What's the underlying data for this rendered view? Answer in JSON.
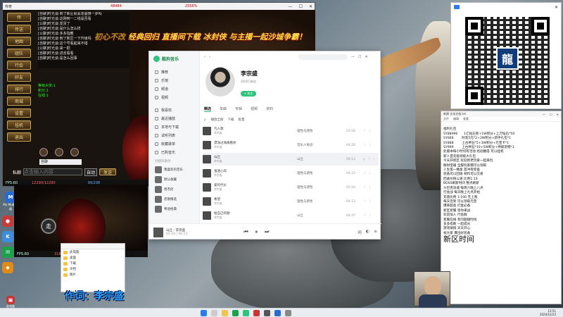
{
  "desktop": {
    "icons_left": [
      {
        "label": "Mu Mu模拟器",
        "color": "#2a6bd1"
      },
      {
        "label": "",
        "color": "#c73a3a"
      },
      {
        "label": "",
        "color": "#3b8de0"
      },
      {
        "label": "",
        "color": "#1aa34a"
      },
      {
        "label": "",
        "color": "#e08a1a"
      }
    ],
    "icons_bottom": [
      {
        "label": "此电脑",
        "color": "#c33"
      }
    ],
    "caption_label": "作词：",
    "caption_name": "李宗盛"
  },
  "game": {
    "window_title": "传奇",
    "counter_left": "48484",
    "counter_right": "2556%",
    "banner": "初心不改  经典回归  直播间下载  冰封侠  与主播一起沙城争霸！",
    "menu_buttons": [
      "传",
      "传送",
      "地图",
      "组队",
      "行会",
      "好友",
      "排行",
      "商城",
      "设置",
      "挂机",
      "退出"
    ],
    "chat": [
      "[自聊]时光谈:到了新区就会发展慢一步吗",
      "[自聊]时光谈:这刚到一二线是否看",
      "[公聊]时光谈:发货了",
      "[自聊]时光谈:是什么怎么样",
      "[公聊]时光谈:多多指教",
      "[自聊]时光谈:到了新区一下升级吗",
      "[自聊]时光谈:这个号看起来不错",
      "[公聊]时光谈:来一把",
      "[自聊]时光谈:进去看看",
      "[自聊]时光谈:是怎么回事"
    ],
    "chat_highlight": [
      "等级大奖:1",
      "积分:1",
      "在线:1"
    ],
    "channel": "自聊",
    "private_label": "私聊",
    "input_placeholder": "点击输入内容",
    "auto_label": "自动",
    "send_label": "发送",
    "hud_fps": "FPS:60",
    "hud_hp": "12290/12290",
    "hud_mp": "99/298",
    "bottom_fps": "FPS:60",
    "bottom_hp": "31844/31844",
    "walk_label": "走"
  },
  "music": {
    "app_name": "酷狗音乐",
    "nav": [
      "推荐",
      "乐馆",
      "频道",
      "视频"
    ],
    "nav2": [
      "我喜欢",
      "最近播放",
      "本地与下载",
      "试听列表",
      "收藏歌单",
      "已购音乐"
    ],
    "section_playlists": "创建的歌单",
    "playlists": [
      "我喜欢的音乐",
      "默认收藏",
      "周杰伦",
      "老歌精选",
      "粤语经典"
    ],
    "artist": "李宗盛",
    "artist_sub": "2000万粉丝",
    "follow": "+ 关注",
    "tabs": [
      "精选",
      "单曲",
      "专辑",
      "视频",
      "资料"
    ],
    "toolbar": [
      "播放全部",
      "下载",
      "批量"
    ],
    "songs": [
      {
        "name": "凡人歌",
        "artist": "李宗盛",
        "album": "理性与感性",
        "duration": "03:58"
      },
      {
        "name": "漂洋过海来看你",
        "artist": "李宗盛",
        "album": "音乐人奇迹",
        "duration": "04:26"
      },
      {
        "name": "山丘",
        "artist": "李宗盛",
        "album": "山丘",
        "duration": "06:12"
      },
      {
        "name": "鬼迷心窍",
        "artist": "李宗盛",
        "album": "理性与感性",
        "duration": "04:33"
      },
      {
        "name": "爱的代价",
        "artist": "李宗盛",
        "album": "理性与感性",
        "duration": "05:16"
      },
      {
        "name": "希望",
        "artist": "李宗盛",
        "album": "理性与感性",
        "duration": "04:12"
      },
      {
        "name": "给自己的歌",
        "artist": "李宗盛",
        "album": "山丘",
        "duration": "04:47"
      }
    ],
    "now_playing": "山丘 - 李宗盛",
    "now_time": "02:18 / 06:12"
  },
  "notepad": {
    "title": "新建 文本文档.txt",
    "menu": [
      "文件",
      "编辑",
      "查看"
    ],
    "lines": [
      "福利礼包",
      "SY88996      1亿钻石卷+1W积分+上万钻石*50",
      "SY666        时装5元*2+2W积分+新手礼包*1",
      "SY888        上古神石*5+3W积分+元宝卡*1",
      "SY999        上古神石*10+5W积分+神级宠物*1",
      "此版本每小时均有活动 经验翻倍 可以挂机",
      "新人首充能领取大礼包",
      "今天开新区 欢迎新老玩家一起来玩",
      "散财宝箱 全服玩家都可以领取",
      "人生第一桶金 首冲有惊喜",
      "装备可以回收 材料可以交易",
      "回收价格公道 比例1:10",
      "BOSS刷新时间 整点刷新",
      "沙巴克攻城 每周六晚上八点",
      "行会战 每天晚上九点开始",
      "充值比例 1:100 无上限",
      "每天签到 可以领取元宝",
      "爆率超高 打金必备",
      "新区新服 等你来战",
      "欢迎加入 行会群",
      "客服在线 有问题随时找",
      "多多指教 一起成长",
      "游戏愉快 天天开心",
      "祝大家 爆出好装备"
    ],
    "footer": "新区时间"
  },
  "files": {
    "rows": [
      "此电脑",
      "桌面",
      "下载",
      "文档",
      "图片"
    ]
  },
  "taskbar": {
    "time": "13:51",
    "date": "2024/12/23"
  }
}
